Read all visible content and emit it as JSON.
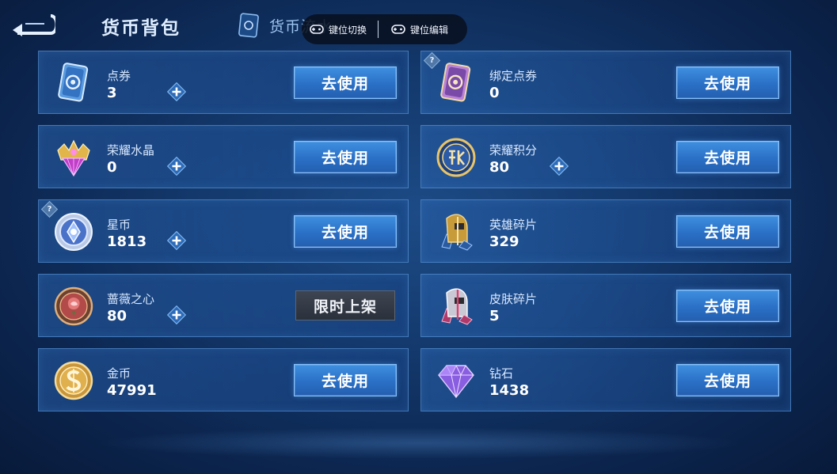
{
  "header": {
    "title": "货币背包",
    "tab_flow_label": "货币流水",
    "keybar": {
      "switch_label": "键位切换",
      "edit_label": "键位编辑"
    }
  },
  "items": [
    {
      "name": "点券",
      "count": "3",
      "button": "去使用"
    },
    {
      "name": "绑定点券",
      "count": "0",
      "button": "去使用"
    },
    {
      "name": "荣耀水晶",
      "count": "0",
      "button": "去使用"
    },
    {
      "name": "荣耀积分",
      "count": "80",
      "button": "去使用"
    },
    {
      "name": "星币",
      "count": "1813",
      "button": "去使用"
    },
    {
      "name": "英雄碎片",
      "count": "329",
      "button": "去使用"
    },
    {
      "name": "蔷薇之心",
      "count": "80",
      "button": "限时上架"
    },
    {
      "name": "皮肤碎片",
      "count": "5",
      "button": "去使用"
    },
    {
      "name": "金币",
      "count": "47991",
      "button": "去使用"
    },
    {
      "name": "钻石",
      "count": "1438",
      "button": "去使用"
    }
  ],
  "help_marker": "?",
  "colors": {
    "accent": "#2a70c6",
    "card_border": "#64a0e1",
    "background": "#143a6e"
  }
}
